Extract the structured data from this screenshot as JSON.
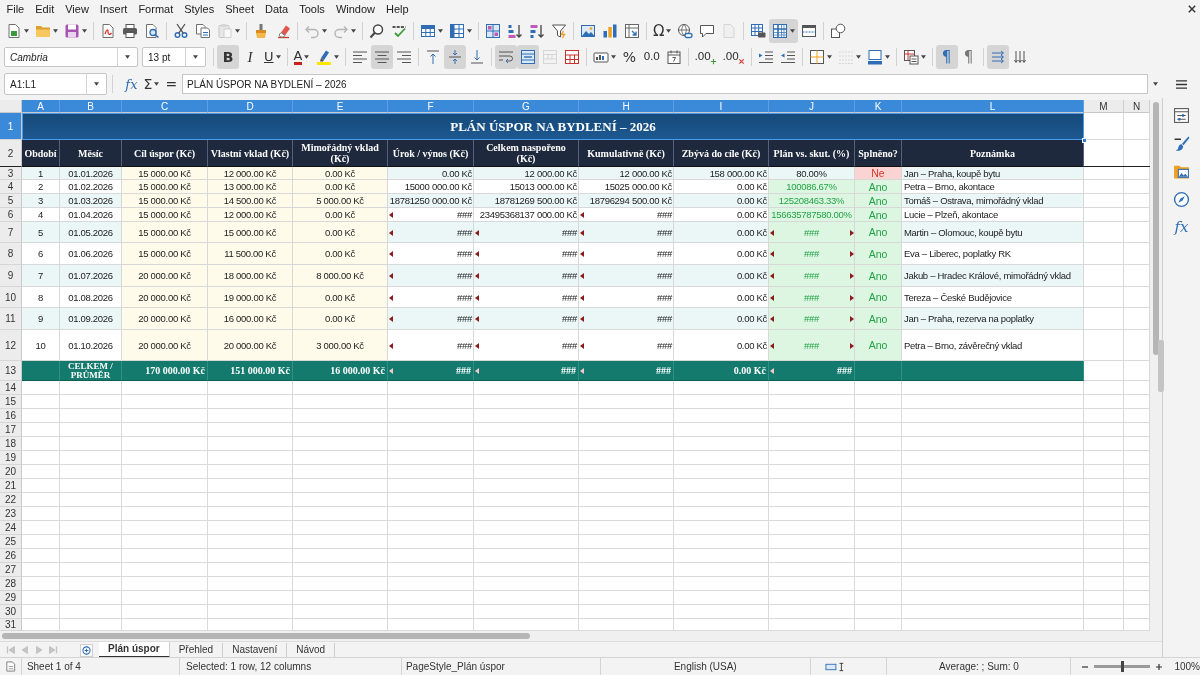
{
  "menu": [
    "File",
    "Edit",
    "View",
    "Insert",
    "Format",
    "Styles",
    "Sheet",
    "Data",
    "Tools",
    "Window",
    "Help"
  ],
  "standard_toolbar": [
    [
      {
        "kind": "new",
        "pressed": false,
        "disabled": false,
        "dropdown": true
      },
      {
        "kind": "open",
        "pressed": false,
        "disabled": false,
        "dropdown": true
      },
      {
        "kind": "save",
        "pressed": false,
        "disabled": false,
        "dropdown": true
      }
    ],
    [
      {
        "kind": "pdf",
        "pressed": false,
        "disabled": false
      },
      {
        "kind": "print",
        "pressed": false,
        "disabled": false
      },
      {
        "kind": "preview",
        "pressed": false,
        "disabled": false
      }
    ],
    [
      {
        "kind": "cut",
        "pressed": false,
        "disabled": false
      },
      {
        "kind": "copy",
        "pressed": false,
        "disabled": false
      },
      {
        "kind": "paste",
        "pressed": false,
        "disabled": true,
        "dropdown": true
      }
    ],
    [
      {
        "kind": "clone",
        "pressed": false,
        "disabled": false
      },
      {
        "kind": "clear",
        "pressed": false,
        "disabled": false
      }
    ],
    [
      {
        "kind": "undo",
        "pressed": false,
        "disabled": true,
        "dropdown": true
      },
      {
        "kind": "redo",
        "pressed": false,
        "disabled": true,
        "dropdown": true
      }
    ],
    [
      {
        "kind": "find",
        "pressed": false,
        "disabled": false
      },
      {
        "kind": "spelling",
        "pressed": false,
        "disabled": false
      }
    ],
    [
      {
        "kind": "row",
        "pressed": false,
        "disabled": false,
        "dropdown": true
      },
      {
        "kind": "column",
        "pressed": false,
        "disabled": false,
        "dropdown": true
      }
    ],
    [
      {
        "kind": "sort",
        "pressed": false,
        "disabled": false
      },
      {
        "kind": "ascending",
        "pressed": false,
        "disabled": false
      },
      {
        "kind": "descending",
        "pressed": false,
        "disabled": false
      },
      {
        "kind": "autofilter",
        "pressed": false,
        "disabled": false
      }
    ],
    [
      {
        "kind": "image",
        "pressed": false,
        "disabled": false
      },
      {
        "kind": "chart",
        "pressed": false,
        "disabled": false
      },
      {
        "kind": "pivot",
        "pressed": false,
        "disabled": false
      }
    ],
    [
      {
        "kind": "symbol",
        "label": "Ω",
        "pressed": false,
        "disabled": false,
        "dropdown": true
      },
      {
        "kind": "hyperlink",
        "pressed": false,
        "disabled": false
      },
      {
        "kind": "comment",
        "pressed": false,
        "disabled": false
      },
      {
        "kind": "headers",
        "pressed": false,
        "disabled": true
      }
    ],
    [
      {
        "kind": "printarea",
        "pressed": false,
        "disabled": false
      },
      {
        "kind": "freeze",
        "pressed": true,
        "disabled": false,
        "dropdown": true
      },
      {
        "kind": "split",
        "pressed": false,
        "disabled": false
      }
    ],
    [
      {
        "kind": "draw",
        "pressed": false,
        "disabled": false
      }
    ]
  ],
  "formatting_toolbar": {
    "font_name": "Cambria",
    "font_size": "13 pt",
    "groups": [
      [
        {
          "kind": "bold",
          "label": "B",
          "pressed": true,
          "disabled": false
        },
        {
          "kind": "italic",
          "label": "I",
          "pressed": false,
          "disabled": false
        },
        {
          "kind": "underline",
          "label": "U",
          "pressed": false,
          "disabled": false,
          "dropdown": true
        }
      ],
      [
        {
          "kind": "fontcolor",
          "label": "A",
          "pressed": false,
          "disabled": false,
          "dropdown": true
        },
        {
          "kind": "highlight",
          "pressed": false,
          "disabled": false,
          "dropdown": true
        }
      ],
      [
        {
          "kind": "left",
          "pressed": false,
          "disabled": false
        },
        {
          "kind": "center",
          "pressed": true,
          "disabled": false
        },
        {
          "kind": "right",
          "pressed": false,
          "disabled": false
        }
      ],
      [
        {
          "kind": "top",
          "pressed": false,
          "disabled": false
        },
        {
          "kind": "middle",
          "pressed": true,
          "disabled": false
        },
        {
          "kind": "bottom",
          "pressed": false,
          "disabled": false
        }
      ],
      [
        {
          "kind": "wrap",
          "pressed": true,
          "disabled": false
        },
        {
          "kind": "mergecenter",
          "pressed": true,
          "disabled": false
        },
        {
          "kind": "unmerge",
          "pressed": false,
          "disabled": true
        },
        {
          "kind": "merge",
          "pressed": false,
          "disabled": false
        }
      ],
      [
        {
          "kind": "numberformat",
          "pressed": false,
          "disabled": false,
          "dropdown": true
        },
        {
          "kind": "percent",
          "label": "%",
          "pressed": false,
          "disabled": false
        },
        {
          "kind": "standard",
          "label": "0.0",
          "pressed": false,
          "disabled": false
        },
        {
          "kind": "date",
          "pressed": false,
          "disabled": false
        }
      ],
      [
        {
          "kind": "adddecimal",
          "label": ".00",
          "pressed": false,
          "disabled": false
        },
        {
          "kind": "deletedecimal",
          "label": ".00",
          "pressed": false,
          "disabled": false
        }
      ],
      [
        {
          "kind": "indent",
          "pressed": false,
          "disabled": false
        },
        {
          "kind": "outdent",
          "pressed": false,
          "disabled": false
        }
      ],
      [
        {
          "kind": "borders",
          "pressed": false,
          "disabled": false,
          "dropdown": true
        },
        {
          "kind": "borderstyle",
          "pressed": false,
          "disabled": true,
          "dropdown": true
        },
        {
          "kind": "bordercolor",
          "pressed": false,
          "disabled": false,
          "dropdown": true
        }
      ],
      [
        {
          "kind": "conditional",
          "pressed": false,
          "disabled": false,
          "dropdown": true
        }
      ],
      [
        {
          "kind": "ltr",
          "label": "¶",
          "pressed": true,
          "disabled": false
        },
        {
          "kind": "rtl",
          "label": "¶",
          "pressed": false,
          "disabled": false
        }
      ],
      [
        {
          "kind": "horizontal",
          "pressed": true,
          "disabled": false
        },
        {
          "kind": "vertical",
          "pressed": false,
          "disabled": false
        }
      ]
    ]
  },
  "formula_bar": {
    "cell_reference": "A1:L1",
    "buttons": [
      {
        "kind": "wizard",
        "label": "fx"
      },
      {
        "kind": "sum",
        "label": "Σ",
        "dropdown": true
      },
      {
        "kind": "formula",
        "label": "="
      }
    ],
    "content": "PLÁN ÚSPOR NA BYDLENÍ – 2026"
  },
  "sidebar": [
    {
      "kind": "properties"
    },
    {
      "kind": "styles"
    },
    {
      "kind": "gallery"
    },
    {
      "kind": "navigator"
    },
    {
      "kind": "functions",
      "label": "fx"
    }
  ],
  "columns": [
    {
      "letter": "A",
      "selected": true
    },
    {
      "letter": "B",
      "selected": true
    },
    {
      "letter": "C",
      "selected": true
    },
    {
      "letter": "D",
      "selected": true
    },
    {
      "letter": "E",
      "selected": true
    },
    {
      "letter": "F",
      "selected": true
    },
    {
      "letter": "G",
      "selected": true
    },
    {
      "letter": "H",
      "selected": true
    },
    {
      "letter": "I",
      "selected": true
    },
    {
      "letter": "J",
      "selected": true
    },
    {
      "letter": "K",
      "selected": true
    },
    {
      "letter": "L",
      "selected": true
    },
    {
      "letter": "M",
      "selected": false
    },
    {
      "letter": "N",
      "selected": false
    }
  ],
  "row_headers": [
    {
      "label": "1",
      "selected": true
    },
    {
      "label": "2",
      "selected": false
    },
    {
      "label": "3",
      "selected": false
    },
    {
      "label": "4",
      "selected": false
    },
    {
      "label": "5",
      "selected": false
    },
    {
      "label": "6",
      "selected": false
    },
    {
      "label": "7",
      "selected": false
    },
    {
      "label": "8",
      "selected": false
    },
    {
      "label": "9",
      "selected": false
    },
    {
      "label": "10",
      "selected": false
    },
    {
      "label": "11",
      "selected": false
    },
    {
      "label": "12",
      "selected": false
    },
    {
      "label": "13",
      "selected": false
    },
    {
      "label": "14",
      "selected": false
    },
    {
      "label": "15",
      "selected": false
    },
    {
      "label": "16",
      "selected": false
    },
    {
      "label": "17",
      "selected": false
    },
    {
      "label": "18",
      "selected": false
    },
    {
      "label": "19",
      "selected": false
    },
    {
      "label": "20",
      "selected": false
    },
    {
      "label": "21",
      "selected": false
    },
    {
      "label": "22",
      "selected": false
    },
    {
      "label": "23",
      "selected": false
    },
    {
      "label": "24",
      "selected": false
    },
    {
      "label": "25",
      "selected": false
    },
    {
      "label": "26",
      "selected": false
    },
    {
      "label": "27",
      "selected": false
    },
    {
      "label": "28",
      "selected": false
    },
    {
      "label": "29",
      "selected": false
    },
    {
      "label": "30",
      "selected": false
    },
    {
      "label": "31",
      "selected": false
    }
  ],
  "sheet": {
    "title": {
      "text": "PLÁN ÚSPOR NA BYDLENÍ – 2026",
      "selected": true
    },
    "headers": [
      "Období",
      "Měsíc",
      "Cíl úspor (Kč)",
      "Vlastní vklad (Kč)",
      "Mimořádný vklad (Kč)",
      "Úrok / výnos (Kč)",
      "Celkem naspořeno (Kč)",
      "Kumulativně (Kč)",
      "Zbývá do cíle (Kč)",
      "Plán vs. skut. (%)",
      "Splněno?",
      "Poznámka"
    ],
    "rows": [
      {
        "cells": [
          "1",
          "01.01.2026",
          "15 000.00 Kč",
          "12 000.00 Kč",
          "0.00 Kč",
          "0.00 Kč",
          "12 000.00 Kč",
          "12 000.00 Kč",
          "158 000.00 Kč",
          "80.00%",
          "Ne",
          "Jan – Praha, koupě bytu"
        ],
        "met": false,
        "clipped": [
          false,
          false,
          false,
          false,
          false,
          false,
          false,
          false,
          false,
          false,
          false,
          false
        ]
      },
      {
        "cells": [
          "2",
          "01.02.2026",
          "15 000.00 Kč",
          "13 000.00 Kč",
          "0.00 Kč",
          "15000 000.00 Kč",
          "15013 000.00 Kč",
          "15025 000.00 Kč",
          "0.00 Kč",
          "100086.67%",
          "Ano",
          "Petra – Brno, akontace"
        ],
        "met": true,
        "clipped": [
          false,
          false,
          false,
          false,
          false,
          false,
          false,
          false,
          false,
          false,
          false,
          false
        ]
      },
      {
        "cells": [
          "3",
          "01.03.2026",
          "15 000.00 Kč",
          "14 500.00 Kč",
          "5 000.00 Kč",
          "18781250 000.00 Kč",
          "18781269 500.00 Kč",
          "18796294 500.00 Kč",
          "0.00 Kč",
          "125208463.33%",
          "Ano",
          "Tomáš – Ostrava, mimořádný vklad"
        ],
        "met": true,
        "clipped": [
          false,
          false,
          false,
          false,
          false,
          false,
          false,
          false,
          false,
          false,
          false,
          false
        ]
      },
      {
        "cells": [
          "4",
          "01.04.2026",
          "15 000.00 Kč",
          "12 000.00 Kč",
          "0.00 Kč",
          "###",
          "23495368137 000.00 Kč",
          "###",
          "0.00 Kč",
          "156635787580.00%",
          "Ano",
          "Lucie – Plzeň, akontace"
        ],
        "met": true,
        "clipped": [
          false,
          false,
          false,
          false,
          false,
          true,
          false,
          true,
          false,
          false,
          false,
          false
        ]
      },
      {
        "cells": [
          "5",
          "01.05.2026",
          "15 000.00 Kč",
          "15 000.00 Kč",
          "0.00 Kč",
          "###",
          "###",
          "###",
          "0.00 Kč",
          "###",
          "Ano",
          "Martin – Olomouc, koupě bytu"
        ],
        "met": true,
        "clipped": [
          false,
          false,
          false,
          false,
          false,
          true,
          true,
          true,
          false,
          true,
          false,
          false
        ]
      },
      {
        "cells": [
          "6",
          "01.06.2026",
          "15 000.00 Kč",
          "11 500.00 Kč",
          "0.00 Kč",
          "###",
          "###",
          "###",
          "0.00 Kč",
          "###",
          "Ano",
          "Eva – Liberec, poplatky RK"
        ],
        "met": true,
        "clipped": [
          false,
          false,
          false,
          false,
          false,
          true,
          true,
          true,
          false,
          true,
          false,
          false
        ]
      },
      {
        "cells": [
          "7",
          "01.07.2026",
          "20 000.00 Kč",
          "18 000.00 Kč",
          "8 000.00 Kč",
          "###",
          "###",
          "###",
          "0.00 Kč",
          "###",
          "Ano",
          "Jakub – Hradec Králové, mimořádný vklad"
        ],
        "met": true,
        "clipped": [
          false,
          false,
          false,
          false,
          false,
          true,
          true,
          true,
          false,
          true,
          false,
          false
        ]
      },
      {
        "cells": [
          "8",
          "01.08.2026",
          "20 000.00 Kč",
          "19 000.00 Kč",
          "0.00 Kč",
          "###",
          "###",
          "###",
          "0.00 Kč",
          "###",
          "Ano",
          "Tereza – České Budějovice"
        ],
        "met": true,
        "clipped": [
          false,
          false,
          false,
          false,
          false,
          true,
          true,
          true,
          false,
          true,
          false,
          false
        ]
      },
      {
        "cells": [
          "9",
          "01.09.2026",
          "20 000.00 Kč",
          "16 000.00 Kč",
          "0.00 Kč",
          "###",
          "###",
          "###",
          "0.00 Kč",
          "###",
          "Ano",
          "Jan – Praha, rezerva na poplatky"
        ],
        "met": true,
        "clipped": [
          false,
          false,
          false,
          false,
          false,
          true,
          true,
          true,
          false,
          true,
          false,
          false
        ]
      },
      {
        "cells": [
          "10",
          "01.10.2026",
          "20 000.00 Kč",
          "20 000.00 Kč",
          "3 000.00 Kč",
          "###",
          "###",
          "###",
          "0.00 Kč",
          "###",
          "Ano",
          "Petra – Brno, závěrečný vklad"
        ],
        "met": true,
        "clipped": [
          false,
          false,
          false,
          false,
          false,
          true,
          true,
          true,
          false,
          true,
          false,
          false
        ]
      }
    ],
    "totals": {
      "label": "CELKEM / PRŮMĚR",
      "values": [
        "170 000.00 Kč",
        "151 000.00 Kč",
        "16 000.00 Kč",
        "###",
        "###",
        "###",
        "0.00 Kč",
        "###"
      ],
      "clipped": [
        false,
        false,
        false,
        true,
        true,
        true,
        false,
        true
      ]
    }
  },
  "sheet_tabs": {
    "navigation_disabled": true,
    "tabs": [
      {
        "label": "Plán úspor",
        "selected": true
      },
      {
        "label": "Přehled",
        "selected": false
      },
      {
        "label": "Nastavení",
        "selected": false
      },
      {
        "label": "Návod",
        "selected": false
      }
    ]
  },
  "status_bar": {
    "sheet": "Sheet 1 of 4",
    "selection": "Selected: 1 row, 12 columns",
    "page_style": "PageStyle_Plán úspor",
    "language": "English (USA)",
    "summary": "Average: ; Sum: 0",
    "zoom": {
      "level": 0.5,
      "reading": "100%"
    }
  }
}
